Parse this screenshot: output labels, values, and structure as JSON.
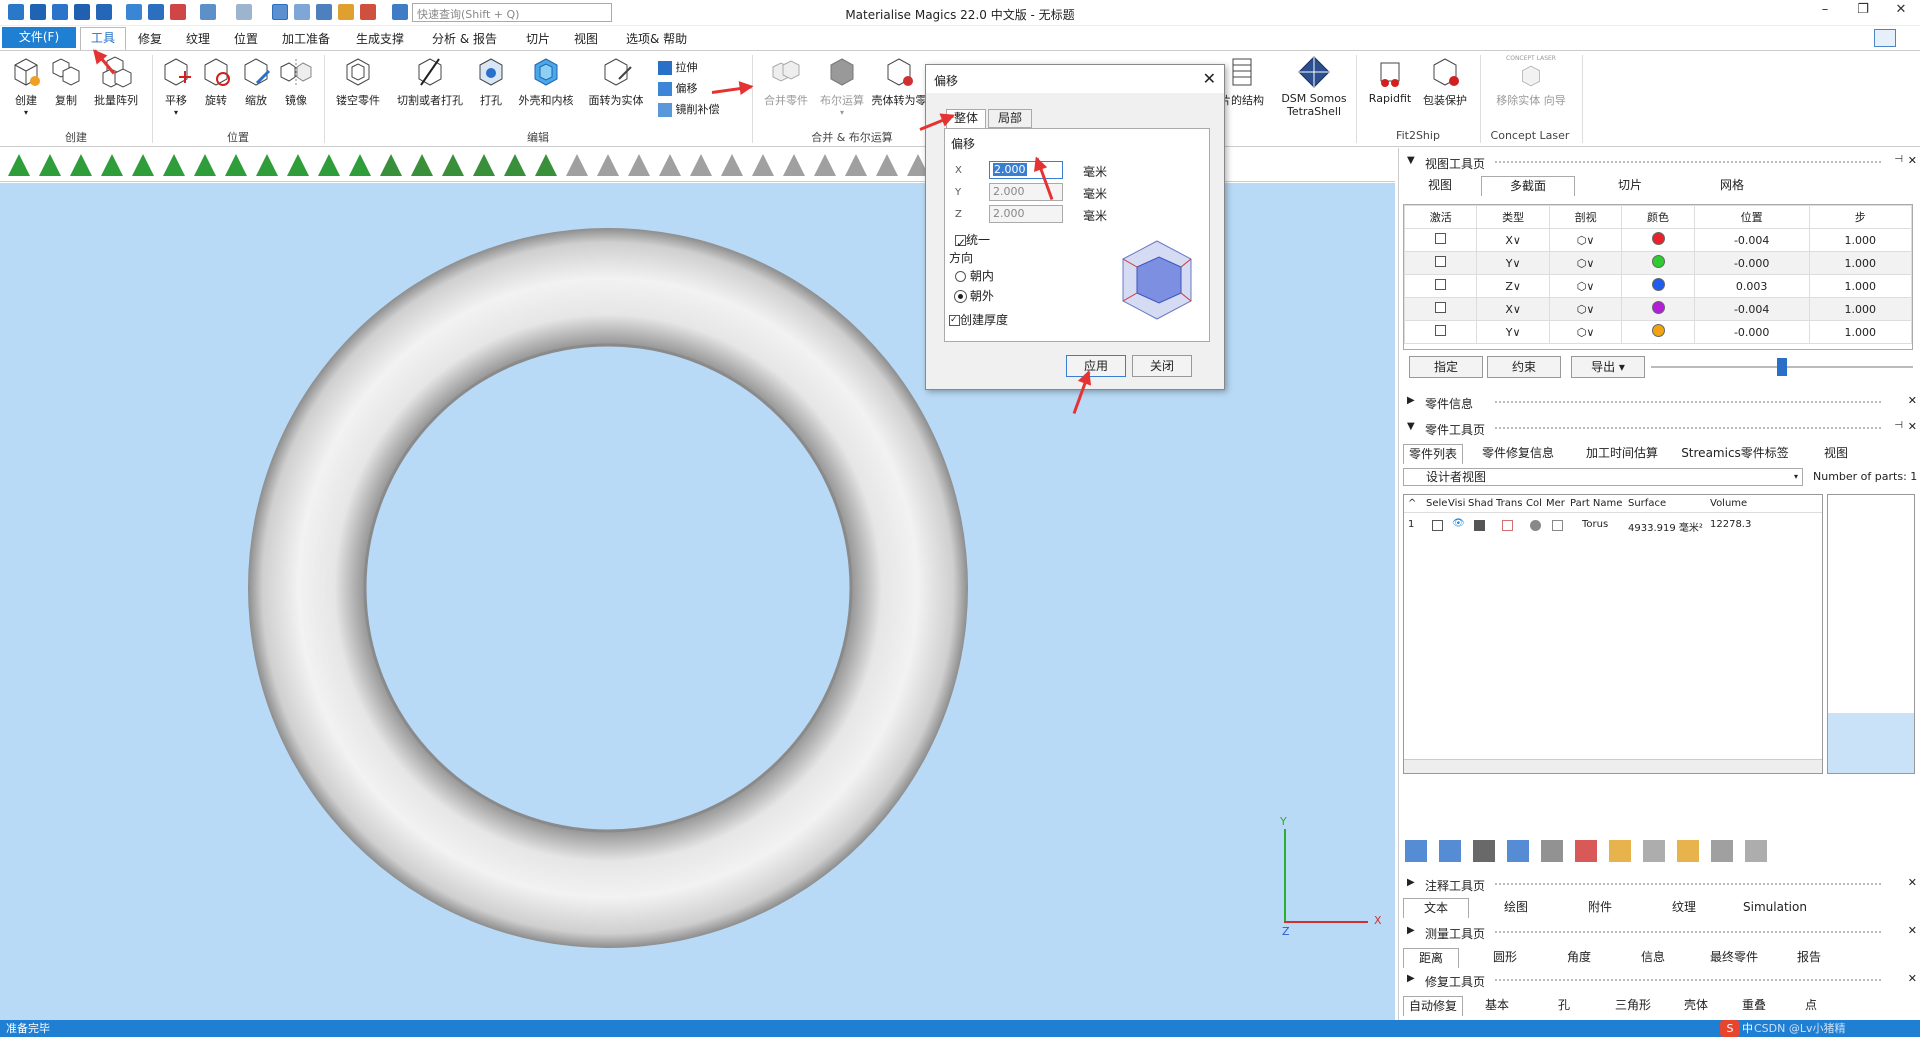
{
  "app": {
    "title": "Materialise Magics 22.0 中文版 - 无标题"
  },
  "search": {
    "placeholder": "快速查询(Shift + Q)"
  },
  "menu": {
    "file": "文件(F)",
    "items": [
      "工具",
      "修复",
      "纹理",
      "位置",
      "加工准备",
      "生成支撑",
      "分析 & 报告",
      "切片",
      "视图",
      "选项& 帮助"
    ]
  },
  "ribbon": {
    "create": [
      "创建",
      "复制",
      "批量阵列"
    ],
    "create_group": "创建",
    "position": [
      "平移",
      "旋转",
      "缩放",
      "镜像"
    ],
    "position_group": "位置",
    "edit": [
      "镂空零件",
      "切割或者打孔",
      "打孔",
      "外壳和内核",
      "面转为实体"
    ],
    "edit_small": [
      "拉伸",
      "偏移",
      "镜削补偿"
    ],
    "edit_group": "编辑",
    "boolean": [
      "合并零件",
      "布尔运算",
      "壳体转为零"
    ],
    "boolean_group": "合并 & 布尔运算",
    "structure": [
      "片的结构",
      "DSM Somos TetraShell"
    ],
    "fit2ship": [
      "Rapidfit",
      "包装保护"
    ],
    "fit2ship_group": "Fit2Ship",
    "laser": [
      "移除实体 向导"
    ],
    "laser_logo": "CONCEPT LASER",
    "laser_group": "Concept Laser"
  },
  "dialog": {
    "title": "偏移",
    "tabs": [
      "整体",
      "局部"
    ],
    "section": "偏移",
    "x_label": "X",
    "x_value": "2.000",
    "y_label": "Y",
    "y_value": "2.000",
    "z_label": "Z",
    "z_value": "2.000",
    "unit": "毫米",
    "uniform": "统一",
    "direction": "方向",
    "inward": "朝内",
    "outward": "朝外",
    "thickness": "创建厚度",
    "apply": "应用",
    "close": "关闭"
  },
  "viewport": {
    "axes": {
      "y": "Y",
      "z": "Z",
      "x": "X"
    }
  },
  "status": "准备完毕",
  "view_tools": {
    "title": "视图工具页",
    "tabs": [
      "视图",
      "多截面",
      "切片",
      "网格"
    ],
    "columns": [
      "激活",
      "类型",
      "剖视",
      "颜色",
      "位置",
      "步"
    ],
    "rows": [
      {
        "type": "X∨",
        "color": "#e8222a",
        "position": "-0.004",
        "step": "1.000"
      },
      {
        "type": "Y∨",
        "color": "#2fcc2f",
        "position": "-0.000",
        "step": "1.000"
      },
      {
        "type": "Z∨",
        "color": "#1f5cf0",
        "position": "0.003",
        "step": "1.000"
      },
      {
        "type": "X∨",
        "color": "#b31fd6",
        "position": "-0.004",
        "step": "1.000"
      },
      {
        "type": "Y∨",
        "color": "#f2a20c",
        "position": "-0.000",
        "step": "1.000"
      }
    ],
    "buttons": [
      "指定",
      "约束",
      "导出"
    ]
  },
  "part_info": {
    "title": "零件信息"
  },
  "part_tools": {
    "title": "零件工具页",
    "tabs": [
      "零件列表",
      "零件修复信息",
      "加工时间估算",
      "Streamics零件标签",
      "视图"
    ],
    "view_select": "设计者视图",
    "count_label": "Number of parts:",
    "count": "1",
    "columns": [
      "Sele",
      "Visi",
      "Shad",
      "Trans",
      "Col",
      "Mer",
      "Part Name",
      "Surface",
      "Volume"
    ],
    "row": {
      "index": "1",
      "name": "Torus",
      "surface": "4933.919 毫米²",
      "volume": "12278.3"
    }
  },
  "annotation_tools": {
    "title": "注释工具页",
    "tabs": [
      "文本",
      "绘图",
      "附件",
      "纹理",
      "Simulation"
    ]
  },
  "measure_tools": {
    "title": "测量工具页",
    "tabs": [
      "距离",
      "圆形",
      "角度",
      "信息",
      "最终零件",
      "报告"
    ]
  },
  "repair_tools": {
    "title": "修复工具页",
    "tabs": [
      "自动修复",
      "基本",
      "孔",
      "三角形",
      "壳体",
      "重叠",
      "点"
    ]
  },
  "watermark": "CSDN @Lv小猪精",
  "ime": "中"
}
